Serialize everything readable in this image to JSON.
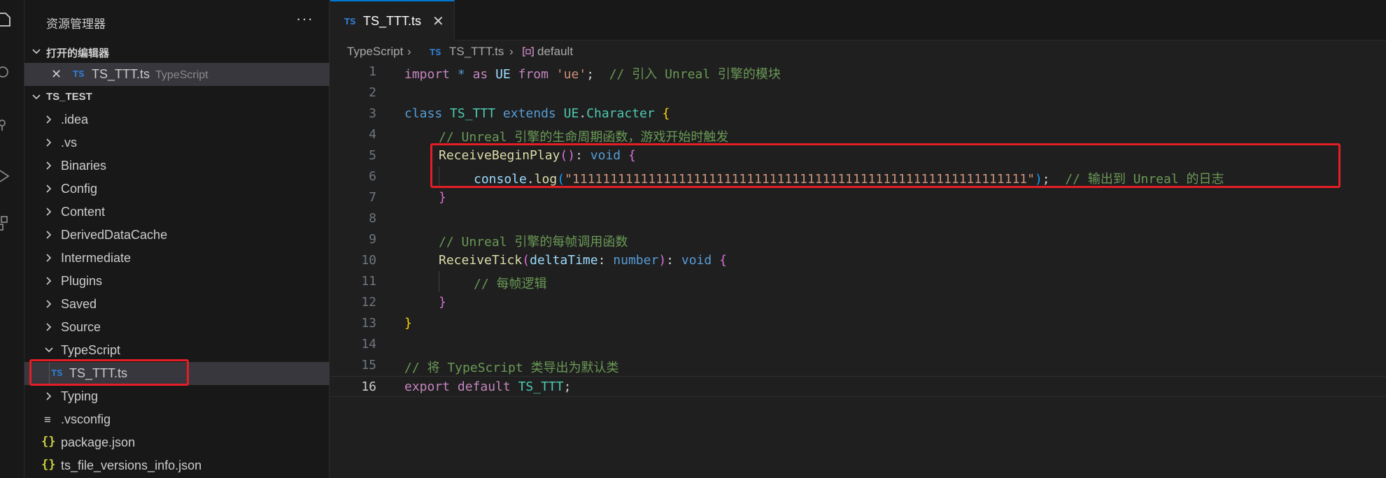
{
  "sidebar": {
    "title": "资源管理器",
    "more": "···",
    "open_editors": {
      "label": "打开的编辑器",
      "file": "TS_TTT.ts",
      "file_hint": "TypeScript",
      "badge": "TS"
    },
    "workspace": {
      "label": "TS_TEST",
      "items": [
        {
          "label": ".idea"
        },
        {
          "label": ".vs"
        },
        {
          "label": "Binaries"
        },
        {
          "label": "Config"
        },
        {
          "label": "Content"
        },
        {
          "label": "DerivedDataCache"
        },
        {
          "label": "Intermediate"
        },
        {
          "label": "Plugins"
        },
        {
          "label": "Saved"
        },
        {
          "label": "Source"
        },
        {
          "label": "TypeScript"
        },
        {
          "label": "TS_TTT.ts",
          "badge": "TS"
        },
        {
          "label": "Typing"
        },
        {
          "label": ".vsconfig",
          "icon": "≡"
        },
        {
          "label": "package.json",
          "badge": "{}"
        },
        {
          "label": "ts_file_versions_info.json",
          "badge": "{}"
        }
      ]
    }
  },
  "tab": {
    "badge": "TS",
    "label": "TS_TTT.ts",
    "close": "✕"
  },
  "breadcrumb": {
    "part1": "TypeScript",
    "badge": "TS",
    "part2": "TS_TTT.ts",
    "part3": "default"
  },
  "editor": {
    "line_numbers": [
      "1",
      "2",
      "3",
      "4",
      "5",
      "6",
      "7",
      "8",
      "9",
      "10",
      "11",
      "12",
      "13",
      "14",
      "15",
      "16"
    ],
    "active_line": "16",
    "tokens": {
      "l1_import": "import",
      "l1_star": "*",
      "l1_as": "as",
      "l1_ue": "UE",
      "l1_from": "from",
      "l1_str": "'ue'",
      "l1_semi": ";",
      "l1_cmt": "// 引入 Unreal 引擎的模块",
      "l3_class": "class",
      "l3_name": "TS_TTT",
      "l3_extends": "extends",
      "l3_ue": "UE",
      "l3_dot": ".",
      "l3_char": "Character",
      "l3_brace": "{",
      "l4_cmt": "// Unreal 引擎的生命周期函数，游戏开始时触发",
      "l5_fn": "ReceiveBeginPlay",
      "l5_parens": "()",
      "l5_colon": ":",
      "l5_void": "void",
      "l5_brace": "{",
      "l6_console": "console",
      "l6_dot": ".",
      "l6_log": "log",
      "l6_open": "(",
      "l6_str": "\"111111111111111111111111111111111111111111111111111111111111\"",
      "l6_close": ")",
      "l6_semi": ";",
      "l6_cmt": "// 输出到 Unreal 的日志",
      "l7_brace": "}",
      "l9_cmt": "// Unreal 引擎的每帧调用函数",
      "l10_fn": "ReceiveTick",
      "l10_open": "(",
      "l10_param": "deltaTime",
      "l10_colon": ":",
      "l10_type": "number",
      "l10_close": ")",
      "l10_colon2": ":",
      "l10_void": "void",
      "l10_brace": "{",
      "l11_cmt": "// 每帧逻辑",
      "l12_brace": "}",
      "l13_brace": "}",
      "l15_cmt": "// 将 TypeScript 类导出为默认类",
      "l16_export": "export",
      "l16_default": "default",
      "l16_name": "TS_TTT",
      "l16_semi": ";"
    }
  },
  "colors": {
    "accent": "#0078d4",
    "highlight_box": "#e51d25",
    "ts_badge": "#3178c6",
    "json_badge": "#cbcb41"
  }
}
